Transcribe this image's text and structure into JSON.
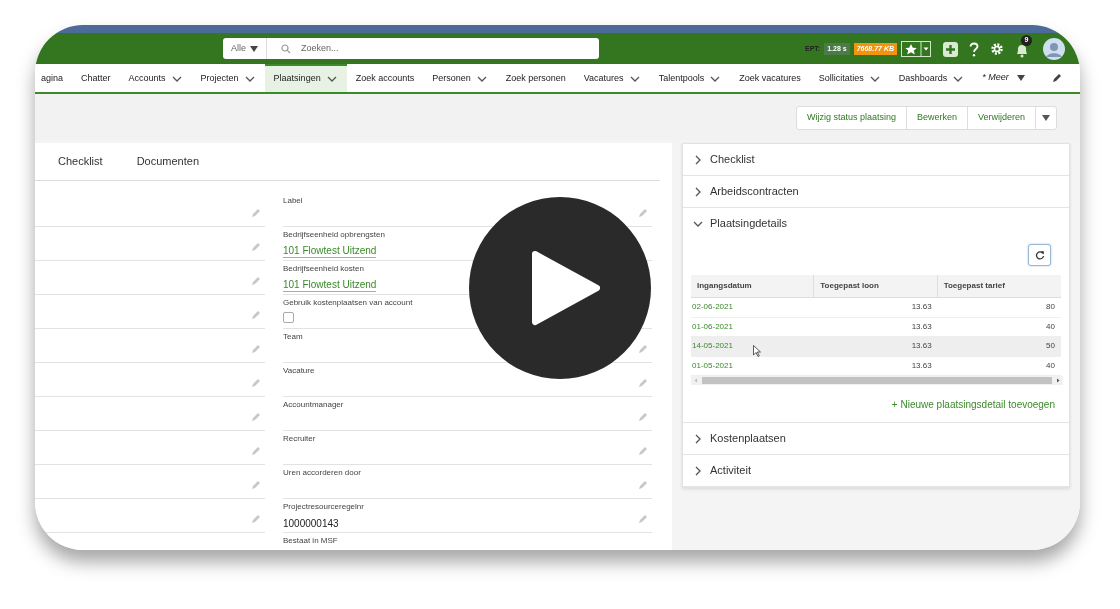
{
  "header": {
    "search_scope": "Alle",
    "search_placeholder": "Zoeken...",
    "ept_label": "EPT:",
    "ept_value": "1.28 s",
    "memory": "7668.77 KB",
    "notification_count": "9"
  },
  "nav": [
    {
      "label": "agina",
      "dropdown": false,
      "selected": false
    },
    {
      "label": "Chatter",
      "dropdown": false,
      "selected": false
    },
    {
      "label": "Accounts",
      "dropdown": true,
      "selected": false
    },
    {
      "label": "Projecten",
      "dropdown": true,
      "selected": false
    },
    {
      "label": "Plaatsingen",
      "dropdown": true,
      "selected": true
    },
    {
      "label": "Zoek accounts",
      "dropdown": false,
      "selected": false
    },
    {
      "label": "Personen",
      "dropdown": true,
      "selected": false
    },
    {
      "label": "Zoek personen",
      "dropdown": false,
      "selected": false
    },
    {
      "label": "Vacatures",
      "dropdown": true,
      "selected": false
    },
    {
      "label": "Talentpools",
      "dropdown": true,
      "selected": false
    },
    {
      "label": "Zoek vacatures",
      "dropdown": false,
      "selected": false
    },
    {
      "label": "Sollicitaties",
      "dropdown": true,
      "selected": false
    },
    {
      "label": "Dashboards",
      "dropdown": true,
      "selected": false
    }
  ],
  "more": "* Meer",
  "actions": [
    "Wijzig status plaatsing",
    "Bewerken",
    "Verwijderen"
  ],
  "tabs": [
    "Checklist",
    "Documenten"
  ],
  "fields": [
    {
      "label": "Label",
      "kind": "text"
    },
    {
      "label": "Bedrijfseenheid opbrengsten",
      "kind": "link",
      "value": "101 Flowtest Uitzend"
    },
    {
      "label": "Bedrijfseenheid kosten",
      "kind": "link",
      "value": "101 Flowtest Uitzend"
    },
    {
      "label": "Gebruik kostenplaatsen van account",
      "kind": "checkbox",
      "checked": false
    },
    {
      "label": "Team",
      "kind": "text"
    },
    {
      "label": "Vacature",
      "kind": "text"
    },
    {
      "label": "Accountmanager",
      "kind": "text"
    },
    {
      "label": "Recruiter",
      "kind": "text"
    },
    {
      "label": "Uren accorderen door",
      "kind": "text"
    },
    {
      "label": "Projectresourceregelnr",
      "kind": "text",
      "value": "1000000143"
    },
    {
      "label": "Bestaat in MSF",
      "kind": "text"
    }
  ],
  "sections": [
    {
      "title": "Checklist",
      "expanded": false
    },
    {
      "title": "Arbeidscontracten",
      "expanded": false
    },
    {
      "title": "Plaatsingdetails",
      "expanded": true,
      "table": {
        "columns": [
          "Ingangsdatum",
          "Toegepast loon",
          "Toegepast tarief"
        ],
        "rows": [
          {
            "cells": [
              "02-06-2021",
              "13.63",
              "80"
            ],
            "highlighted": false
          },
          {
            "cells": [
              "01-06-2021",
              "13.63",
              "40"
            ],
            "highlighted": false
          },
          {
            "cells": [
              "14-05-2021",
              "13.63",
              "50"
            ],
            "highlighted": true
          },
          {
            "cells": [
              "01-05-2021",
              "13.63",
              "40"
            ],
            "highlighted": false
          }
        ]
      },
      "add_link": "+ Nieuwe plaatsingsdetail toevoegen"
    },
    {
      "title": "Kostenplaatsen",
      "expanded": false
    },
    {
      "title": "Activiteit",
      "expanded": false
    }
  ]
}
